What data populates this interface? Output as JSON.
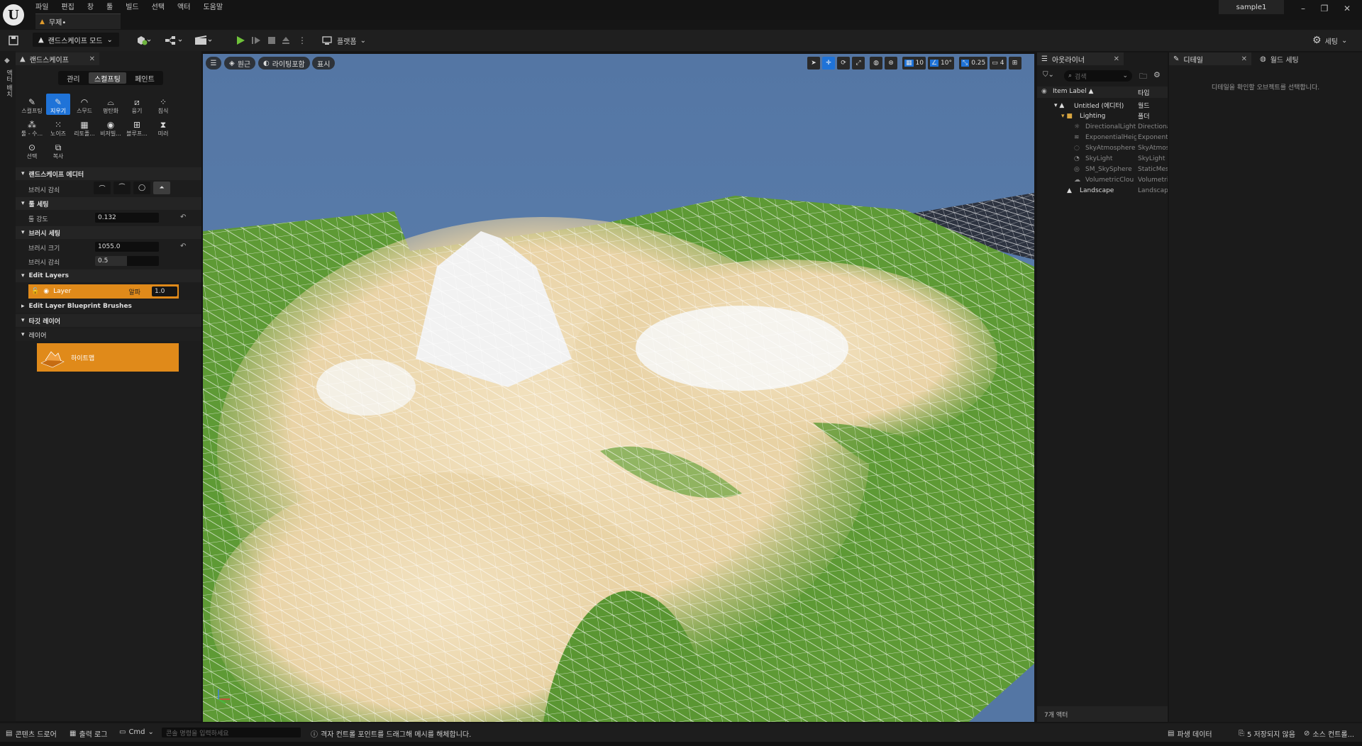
{
  "menubar": {
    "items": [
      "파일",
      "편집",
      "창",
      "툴",
      "빌드",
      "선택",
      "액터",
      "도움말"
    ],
    "project_name": "sample1"
  },
  "level_tab": {
    "label": "무제•"
  },
  "toolbar": {
    "mode_label": "랜드스케이프 모드",
    "platform_label": "플랫폼",
    "settings_label": "세팅"
  },
  "left_strip": {
    "label": "액터 배치"
  },
  "landscape_panel": {
    "tab_label": "랜드스케이프",
    "mode_tabs": [
      "관리",
      "스컬프팅",
      "페인트"
    ],
    "active_mode": "스컬프팅",
    "tools_row1": [
      "스컬프팅",
      "지우기",
      "스무드",
      "평탄화",
      "융기",
      "침식"
    ],
    "tools_row2": [
      "툴 - 수...",
      "노이즈",
      "리토폴...",
      "비저빌...",
      "블루프...",
      "미러"
    ],
    "tools_row3": [
      "선택",
      "복사"
    ],
    "active_tool": "지우기",
    "sections": {
      "editor": "랜드스케이프 에디터",
      "brush_falloff": "브러시 감쇠",
      "tool_settings": "툴 세팅",
      "tool_strength": "툴 강도",
      "tool_strength_value": "0.132",
      "brush_settings": "브러시 세팅",
      "brush_size": "브러시 크기",
      "brush_size_value": "1055.0",
      "brush_falloff2": "브러시 감쇠",
      "brush_falloff_value": "0.5",
      "edit_layers": "Edit Layers",
      "layer_name": "Layer",
      "layer_alpha_label": "알파",
      "layer_alpha_value": "1.0",
      "blueprint_brushes": "Edit Layer Blueprint Brushes",
      "target_layer": "타깃 레이어",
      "layers": "레이어",
      "heightmap": "하이트맵"
    }
  },
  "viewport": {
    "perspective": "원근",
    "lighting": "라이팅포함",
    "show": "표시",
    "grid_snap": "10",
    "rot_snap": "10°",
    "scale_snap": "0.25",
    "cam_speed": "4",
    "colors": {
      "sky": "#5476a4",
      "grass": "#5e9a35",
      "sand": "#ecd7b0",
      "snow": "#f2f2f2"
    }
  },
  "outliner": {
    "tab_label": "아웃라이너",
    "search_placeholder": "검색",
    "col_label": "Item Label ▲",
    "col_type": "타입",
    "rows": [
      {
        "name": "Untitled (에디터)",
        "type": "월드"
      },
      {
        "name": "Lighting",
        "type": "폴더"
      },
      {
        "name": "DirectionalLight",
        "type": "Directional"
      },
      {
        "name": "ExponentialHeig",
        "type": "Exponenti"
      },
      {
        "name": "SkyAtmosphere",
        "type": "SkyAtmos"
      },
      {
        "name": "SkyLight",
        "type": "SkyLight"
      },
      {
        "name": "SM_SkySphere",
        "type": "StaticMes"
      },
      {
        "name": "VolumetricClou",
        "type": "Volumetri"
      },
      {
        "name": "Landscape",
        "type": "Landscap"
      }
    ],
    "footer": "7개 액터"
  },
  "details": {
    "tab_label": "디테일",
    "world_settings_label": "월드 세팅",
    "empty_message": "디테일을 확인할 오브젝트를 선택합니다."
  },
  "statusbar": {
    "content_drawer": "콘텐츠 드로어",
    "output_log": "출력 로그",
    "cmd": "Cmd",
    "cmd_placeholder": "콘솔 명령을 입력하세요",
    "hint": "격자 컨트롤 포인트를 드래그해 메시를 해체합니다.",
    "derived_data": "파생 데이터",
    "unsaved": "5 저장되지 않음",
    "source_control": "소스 컨트롤..."
  }
}
